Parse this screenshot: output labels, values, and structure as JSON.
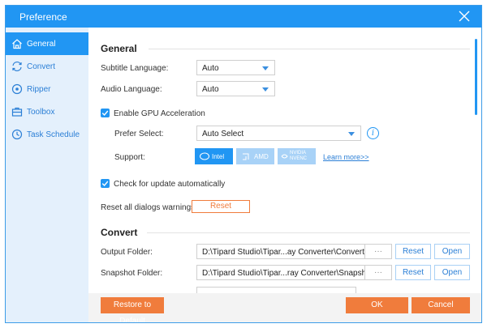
{
  "window": {
    "title": "Preference"
  },
  "sidebar": {
    "items": [
      {
        "label": "General",
        "icon": "home-icon",
        "active": true
      },
      {
        "label": "Convert",
        "icon": "convert-icon",
        "active": false
      },
      {
        "label": "Ripper",
        "icon": "disc-icon",
        "active": false
      },
      {
        "label": "Toolbox",
        "icon": "toolbox-icon",
        "active": false
      },
      {
        "label": "Task Schedule",
        "icon": "clock-icon",
        "active": false
      }
    ]
  },
  "general": {
    "section_title": "General",
    "subtitle_language": {
      "label": "Subtitle Language:",
      "value": "Auto"
    },
    "audio_language": {
      "label": "Audio Language:",
      "value": "Auto"
    },
    "gpu": {
      "label": "Enable GPU Acceleration",
      "checked": true
    },
    "prefer_select": {
      "label": "Prefer Select:",
      "value": "Auto Select"
    },
    "support": {
      "label": "Support:",
      "intel": "Intel",
      "amd": "AMD",
      "nvidia": "NVIDIA NVENC",
      "learn_more": "Learn more>>"
    },
    "check_update": {
      "label": "Check for update automatically",
      "checked": true
    },
    "reset_dialogs": {
      "label": "Reset all dialogs warnings:",
      "button": "Reset"
    }
  },
  "convert": {
    "section_title": "Convert",
    "output_folder": {
      "label": "Output Folder:",
      "value": "D:\\Tipard Studio\\Tipar...ay Converter\\Converted",
      "dots": "···",
      "reset": "Reset",
      "open": "Open"
    },
    "snapshot_folder": {
      "label": "Snapshot Folder:",
      "value": "D:\\Tipard Studio\\Tipar...ray Converter\\Snapshot",
      "dots": "···",
      "reset": "Reset",
      "open": "Open"
    }
  },
  "footer": {
    "restore": "Restore to Default",
    "ok": "OK",
    "cancel": "Cancel"
  },
  "colors": {
    "accent": "#2196f3",
    "orange": "#f07c3c",
    "sidebar_bg": "#e4f0fc",
    "disabled_blue": "#a8d2f7"
  }
}
